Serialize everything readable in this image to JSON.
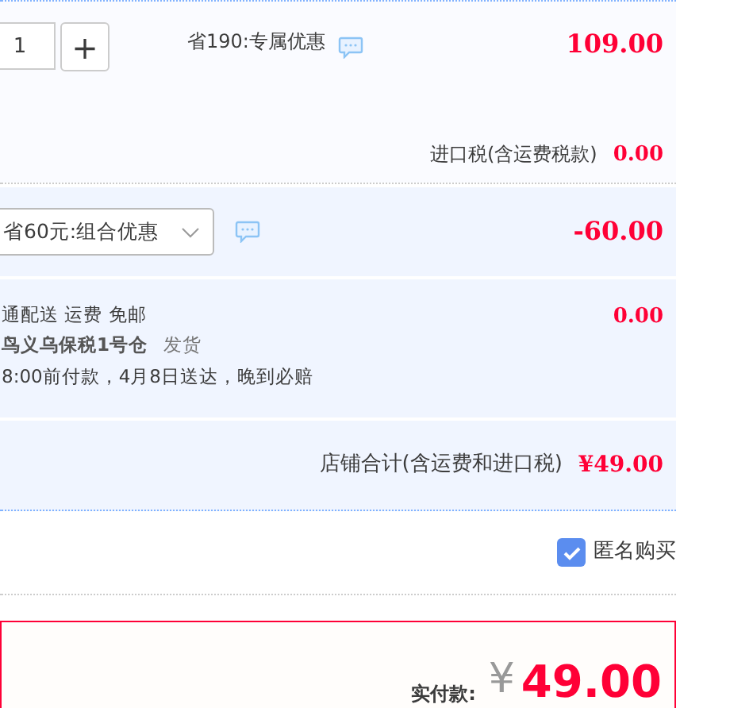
{
  "item": {
    "quantity": "1",
    "plus": "+",
    "promo": "省190:专属优惠",
    "price": "109.00",
    "tax_label": "进口税(含运费税款)",
    "tax": "0.00"
  },
  "combo": {
    "value": "省60元:组合优惠",
    "amount": "-60.00"
  },
  "shipping": {
    "lines": [
      "通配送 运费 免邮",
      "鸟义乌保税1号仓",
      "8:00前付款，4月8日送达，晚到必赔"
    ],
    "ship_word": "发货",
    "fee": "0.00"
  },
  "shop_total": {
    "label": "店铺合计(含运费和进口税)",
    "amount": "¥49.00"
  },
  "anonymous": {
    "label": "匿名购买",
    "checked": true
  },
  "pay": {
    "label": "实付款:",
    "currency": "¥",
    "amount": "49.00"
  }
}
